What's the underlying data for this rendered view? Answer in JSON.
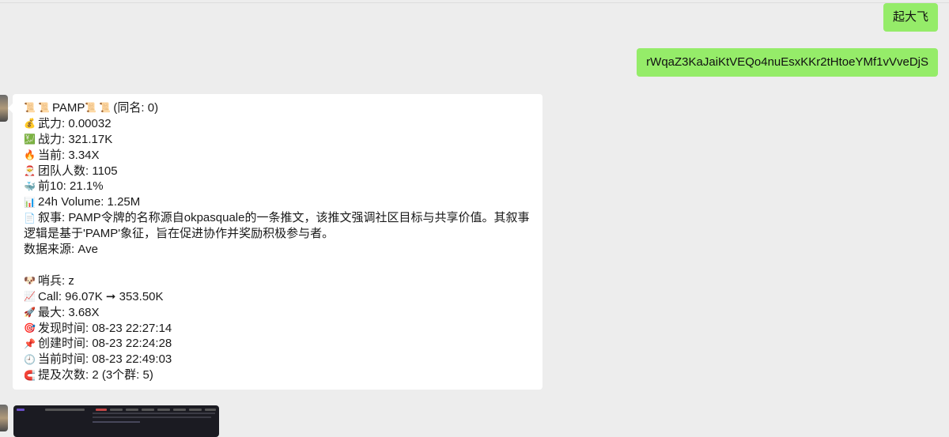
{
  "outgoing": [
    {
      "text": "起大飞"
    },
    {
      "text": "rWqaZ3KaJaiKtVEQo4nuEsxKKr2tHtoeYMf1vVveDjS"
    }
  ],
  "message": {
    "header": {
      "icons": [
        "scroll-icon",
        "scroll-icon"
      ],
      "token": "PAMP",
      "icons_after": [
        "scroll-icon",
        "scroll-icon"
      ],
      "same_name": "(同名: 0)"
    },
    "rows": [
      {
        "icon": "money-bag-icon",
        "glyph": "💰",
        "text": "武力: 0.00032"
      },
      {
        "icon": "chart-up-icon",
        "glyph": "💹",
        "text": "战力: 321.17K"
      },
      {
        "icon": "fire-icon",
        "glyph": "🔥",
        "text": "当前: 3.34X"
      },
      {
        "icon": "santa-icon",
        "glyph": "🎅",
        "text": "团队人数: 1105"
      },
      {
        "icon": "whale-icon",
        "glyph": "🐳",
        "text": "前10: 21.1%"
      },
      {
        "icon": "bar-chart-icon",
        "glyph": "📊",
        "text": "24h Volume: 1.25M"
      }
    ],
    "narrative": {
      "icon": "memo-icon",
      "glyph": "📄",
      "text": "叙事: PAMP令牌的名称源自okpasquale的一条推文，该推文强调社区目标与共享价值。其叙事逻辑是基于'PAMP'象征，旨在促进协作并奖励积极参与者。"
    },
    "source": "数据来源: Ave",
    "rows2": [
      {
        "icon": "dog-face-icon",
        "glyph": "🐶",
        "text": "哨兵: z"
      },
      {
        "icon": "trend-up-icon",
        "glyph": "📈",
        "text": "Call: 96.07K ➞ 353.50K"
      },
      {
        "icon": "rocket-icon",
        "glyph": "🚀",
        "text": "最大: 3.68X"
      },
      {
        "icon": "target-icon",
        "glyph": "🎯",
        "text": "发现时间: 08-23 22:27:14"
      },
      {
        "icon": "pushpin-icon",
        "glyph": "📌",
        "text": "创建时间: 08-23 22:24:28"
      },
      {
        "icon": "clock-icon",
        "glyph": "🕘",
        "text": "当前时间: 08-23 22:49:03"
      },
      {
        "icon": "magnet-icon",
        "glyph": "🧲",
        "text": "提及次数: 2 (3个群: 5)"
      }
    ]
  },
  "colors": {
    "outgoing_bubble": "#95ec69",
    "incoming_bubble": "#ffffff",
    "background": "#ededed"
  }
}
